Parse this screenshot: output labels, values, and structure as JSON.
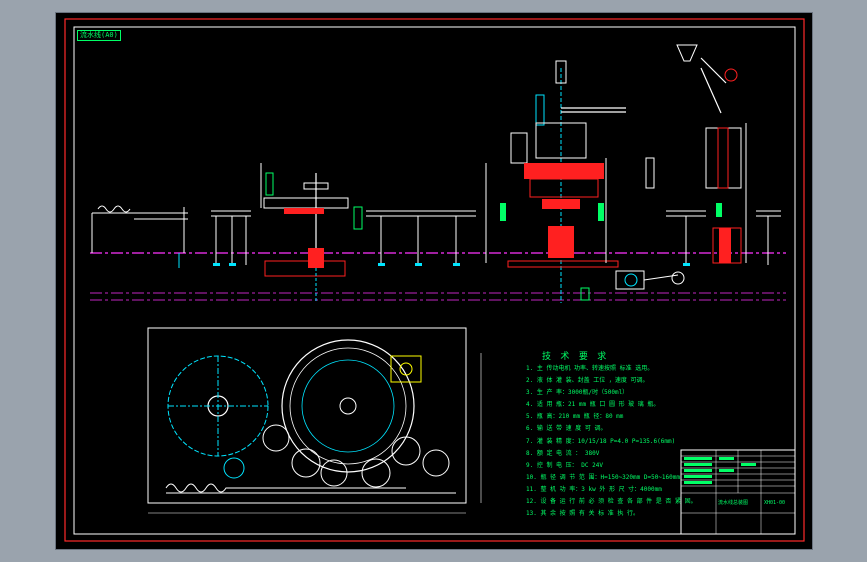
{
  "drawing": {
    "title_tag": "流水线(A0)",
    "tech_requirements": {
      "title": "技 术 要 求",
      "items": [
        "1. 主 传动电机 功率、转速按照 标准 选用。",
        "2. 液 体 灌 装、封盖 工位 ，速度 可调。",
        "3. 生 产 率：3000瓶/时（500ml）",
        "4. 适 用 瓶：21 mm 瓶 口 圆 形 玻 璃 瓶。",
        "5. 瓶 高：210 mm 瓶 径：80 mm",
        "6. 输 送 带 速 度 可 调。",
        "7. 灌 装 精 度：10/15/18  P=4.0  P=135.6(6mm)",
        "8. 额 定 电 流 ：        380V",
        "9. 控 制 电 压：  DC  24V",
        "10. 瓶 径 调 节 范 围：H=150~320mm  D=50~160mm",
        "11. 整 机 功 率：3 kw 外 形 尺 寸：4000mm",
        "12. 设 备 运 行 前 必 须 检 查 各 部 件 是 否 紧 固。",
        "13. 其 余 按 照 有 关 标 准 执 行。"
      ]
    },
    "title_block": {
      "drawing_name": "流水线总装图",
      "drawing_number": "XH01-00"
    }
  },
  "colors": {
    "background": "#000000",
    "frame": "#ff2a2a",
    "machine_white": "#ffffff",
    "cyan": "#00e5ff",
    "red": "#ff2020",
    "magenta": "#ff33ff",
    "green": "#00ff66",
    "yellow": "#ffff00"
  }
}
